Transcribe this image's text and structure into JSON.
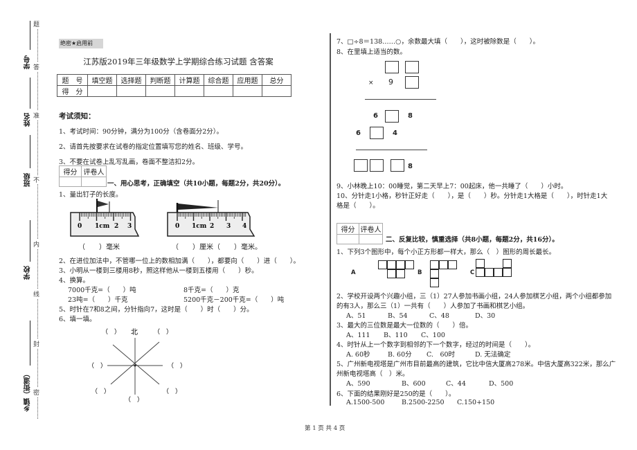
{
  "margin": {
    "fields": [
      "学号",
      "姓名",
      "班级",
      "学校",
      "乡镇（街道）"
    ],
    "seal_chars": [
      "题",
      "答",
      "准",
      "不",
      "内",
      "线",
      "封",
      "密"
    ]
  },
  "header": {
    "secret_label": "绝密★启用前",
    "title": "江苏版2019年三年级数学上学期综合练习试题 含答案"
  },
  "score_table": {
    "headers": [
      "题　号",
      "填空题",
      "选择题",
      "判断题",
      "计算题",
      "综合题",
      "应用题",
      "总分"
    ],
    "row_label": "得　分"
  },
  "notice": {
    "heading": "考试须知：",
    "items": [
      "1、考试时间：90分钟，满分为100分（含卷面分2分）。",
      "2、请首先按要求在试卷的指定位置填写您的姓名、班级、学号。",
      "3、不要在试卷上乱写乱画，卷面不整洁扣2分。"
    ]
  },
  "grader_box": {
    "score": "得分",
    "grader": "评卷人"
  },
  "section1": {
    "heading": "一、用心思考，正确填空（共10小题，每题2分，共20分）。",
    "q1": "1、量出钉子的长度。",
    "ruler1_ticks": [
      "0",
      "1cm",
      "2",
      "3"
    ],
    "ruler2_ticks": [
      "0",
      "1cm",
      "2",
      "3",
      "4"
    ],
    "ans1": "（　　）毫米",
    "ans2": "（　　）厘米（　　）毫米。",
    "q2": "2、在进位加法中，不管哪一位上的数相加满（　　），都要向（　　）进（　　）。",
    "q3": "3、小明从一楼到三楼用8秒，照这样他从一楼到五楼用（　　）秒。",
    "q4": "4、换算。",
    "q4a": "7000千克=（　　）吨",
    "q4b": "8千克=（　　）克",
    "q4c": "23吨=（　　）千克",
    "q4d": "5200千克－200千克=（　　）吨",
    "q5": "5、时针在7和8之间，分针指向7，这时是（　　）时（　　）分。",
    "q6": "6、填一填。",
    "compass_north": "北",
    "compass_blank": "（　）"
  },
  "right": {
    "q7": "7、□÷8＝138……○，余数最大填（　　），这时被除数是（　　）。",
    "q8": "8、在里填上适当的数。",
    "mult_op": "×",
    "mult_digit": "9",
    "row1_left": "6",
    "row1_right": "8",
    "row2_left": "6",
    "row2_right": "4",
    "row3_right": "8",
    "q9": "9、小林晚上10：00睡觉，第二天早上7：00起床，他一共睡了（　　）小时。",
    "q10a": "10、分针走1小格，秒针正好走（　　），是（　　）秒。分针走1大格是（　　），时针走1大",
    "q10b": "格是（　　）。"
  },
  "section2": {
    "heading": "二、反复比较，慎重选择（共8小题，每题2分，共16分）。",
    "q1": "1、下列3个图形中，每个小正方形都一样大，那么（　）图形的周长最长。",
    "shape_labels": [
      "A",
      "B",
      "C"
    ],
    "q2a": "2、学校开设两个兴趣小组，三（1）27人参加书画小组，24人参加棋艺小组，两个小组都参加",
    "q2b": "的有3人，那么三（1）一共有（　　）人参加了书画和棋艺小组。",
    "q2_opts": [
      "A、51",
      "B、54",
      "C、48",
      "D、30"
    ],
    "q3": "3、最大的三位数是最大一位数的（　　）倍。",
    "q3_opts": [
      "A、111",
      "B、110",
      "C、100"
    ],
    "q4": "4、时针从上一个数字到相邻的下一个数字，经过的时间是（　　）。",
    "q4_opts": [
      "A. 60秒",
      "B. 60分",
      "C.　60时",
      "D. 无法确定"
    ],
    "q5a": "5、广州新电视塔是广州市目前最高的建筑，它比中信大厦高278米。中信大厦高322米，那么广",
    "q5b": "州新电视塔高（　）米。",
    "q5_opts": [
      "A、590",
      "B、600",
      "C、44",
      "D、500"
    ],
    "q6": "6、下面的结果刚好是250的是（　　）。",
    "q6_opts": [
      "A.1500-500",
      "B.2500-2250",
      "C.150+150"
    ]
  },
  "footer": "第 1 页 共 4 页"
}
